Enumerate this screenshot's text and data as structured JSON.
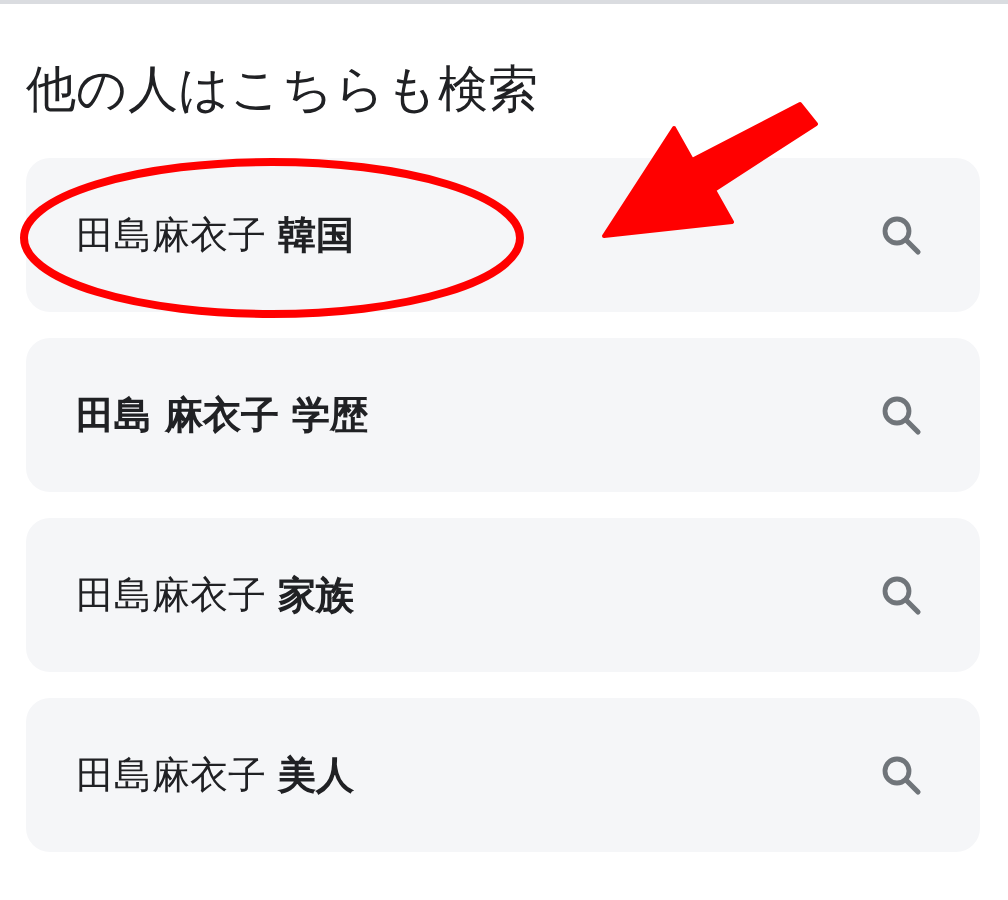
{
  "heading": "他の人はこちらも検索",
  "suggestions": [
    {
      "text": "田島麻衣子 **韓国**",
      "bold": false,
      "circled": true
    },
    {
      "text": "田島 麻衣子 学歴",
      "bold": true,
      "circled": false
    },
    {
      "text": "田島麻衣子 **家族**",
      "bold": false,
      "circled": false
    },
    {
      "text": "田島麻衣子 **美人**",
      "bold": false,
      "circled": false
    }
  ]
}
